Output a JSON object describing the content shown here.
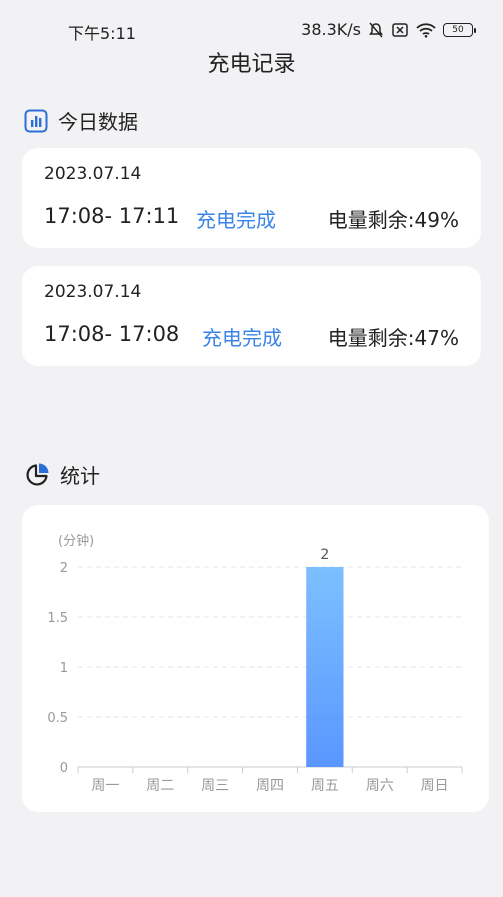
{
  "status_bar": {
    "time": "下午5:11",
    "net_speed": "38.3K/s",
    "battery": "50",
    "icons": [
      "mute-bell-icon",
      "sim-off-icon",
      "wifi-icon",
      "battery-icon"
    ]
  },
  "page": {
    "title": "充电记录"
  },
  "today": {
    "section_label": "今日数据",
    "icon": "bar-chart-icon",
    "records": [
      {
        "date": "2023.07.14",
        "time_range": "17:08- 17:11",
        "status": "充电完成",
        "level": "电量剩余:49%"
      },
      {
        "date": "2023.07.14",
        "time_range": "17:08- 17:08",
        "status": "充电完成",
        "level": "电量剩余:47%"
      }
    ]
  },
  "stats": {
    "section_label": "统计",
    "icon": "pie-chart-icon"
  },
  "colors": {
    "accent": "#3a84e8",
    "bar_top": "#7cc0ff",
    "bar_bottom": "#5a96ff"
  },
  "chart_data": {
    "type": "bar",
    "unit_label": "(分钟)",
    "categories": [
      "周一",
      "周二",
      "周三",
      "周四",
      "周五",
      "周六",
      "周日"
    ],
    "values": [
      0,
      0,
      0,
      0,
      2,
      0,
      0
    ],
    "data_labels": [
      "",
      "",
      "",
      "",
      "2",
      "",
      ""
    ],
    "y_ticks": [
      "0",
      "0.5",
      "1",
      "1.5",
      "2"
    ],
    "ylim": [
      0,
      2
    ],
    "grid": true
  }
}
